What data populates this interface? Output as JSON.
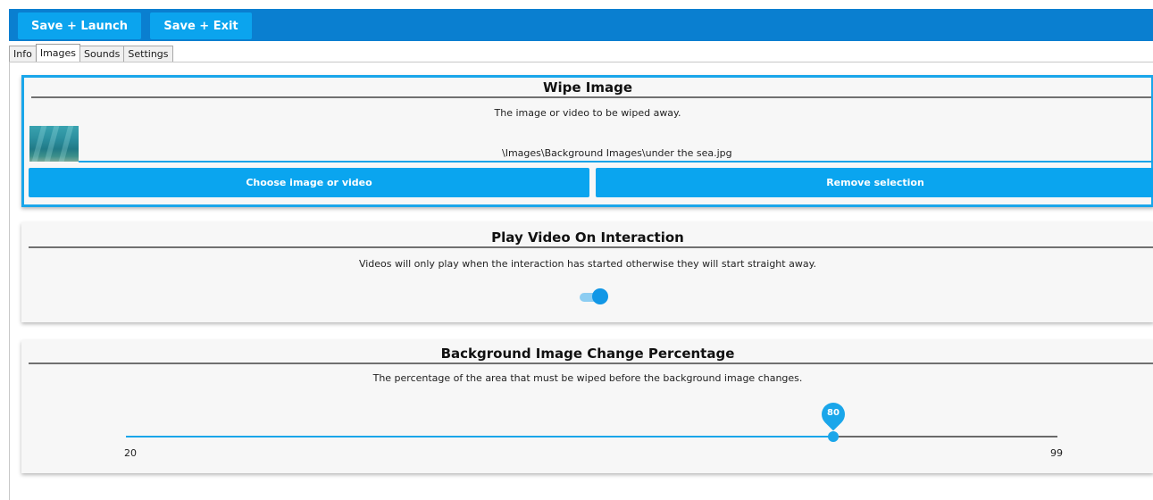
{
  "toolbar": {
    "save_launch_label": "Save + Launch",
    "save_exit_label": "Save + Exit"
  },
  "tabs": [
    {
      "label": "Info",
      "active": false
    },
    {
      "label": "Images",
      "active": true
    },
    {
      "label": "Sounds",
      "active": false
    },
    {
      "label": "Settings",
      "active": false
    }
  ],
  "wipe_image": {
    "title": "Wipe Image",
    "description": "The image or video to be wiped away.",
    "file_path": "\\Images\\Background Images\\under the sea.jpg",
    "choose_label": "Choose image or video",
    "remove_label": "Remove selection"
  },
  "play_video": {
    "title": "Play Video On Interaction",
    "description": "Videos will only play when the interaction has started otherwise they will start straight away.",
    "toggle_on": true
  },
  "bg_change": {
    "title": "Background Image Change Percentage",
    "description": "The percentage of the area that must be wiped before the background image changes.",
    "slider": {
      "min": 20,
      "max": 99,
      "value": 80,
      "min_label": "20",
      "max_label": "99",
      "value_label": "80"
    }
  },
  "colors": {
    "accent": "#1aa6ea",
    "toolbar_bg": "#0a7fd0",
    "button_bg": "#0aa5ef"
  }
}
